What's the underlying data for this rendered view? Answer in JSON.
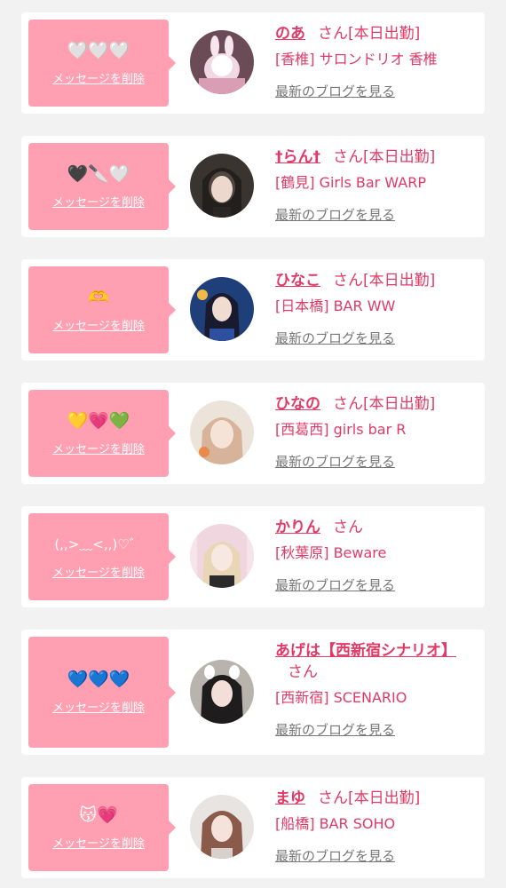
{
  "delete_label": "メッセージを削除",
  "blog_label": "最新のブログを見る",
  "honorific": "さん",
  "items": [
    {
      "message": "🤍🤍🤍",
      "name": "のあ",
      "status": "[本日出勤]",
      "shop": "[香椎] サロンドリオ 香椎"
    },
    {
      "message": "🖤🔪🤍",
      "name": "†らん†",
      "status": "[本日出勤]",
      "shop": "[鶴見] Girls Bar WARP"
    },
    {
      "message": "🫶",
      "name": "ひなこ",
      "status": "[本日出勤]",
      "shop": "[日本橋] BAR WW"
    },
    {
      "message": "💛💗💚",
      "name": "ひなの",
      "status": "[本日出勤]",
      "shop": "[西葛西] girls bar R"
    },
    {
      "message": "(,,>﹏<,,)♡゛",
      "name": "かりん",
      "status": "",
      "shop": "[秋葉原] Beware"
    },
    {
      "message": "💙💙💙",
      "name": "あげは【西新宿シナリオ】",
      "status": "",
      "shop": "[西新宿] SCENARIO"
    },
    {
      "message": "😽💗",
      "name": "まゆ",
      "status": "[本日出勤]",
      "shop": "[船橋] BAR SOHO"
    }
  ]
}
